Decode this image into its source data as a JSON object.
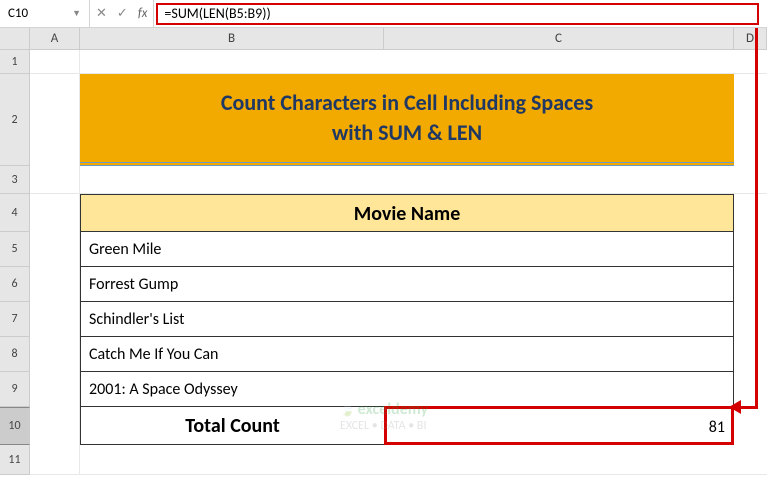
{
  "namebox": {
    "cell_ref": "C10"
  },
  "formula_bar": {
    "formula": "=SUM(LEN(B5:B9))"
  },
  "columns": {
    "A": "A",
    "B": "B",
    "C": "C",
    "D": "D"
  },
  "rows": [
    "1",
    "2",
    "3",
    "4",
    "5",
    "6",
    "7",
    "8",
    "9",
    "10",
    "11"
  ],
  "title": {
    "line1": "Count Characters in Cell Including Spaces",
    "line2": "with SUM & LEN"
  },
  "table": {
    "header": "Movie Name",
    "movies": [
      "Green Mile",
      "Forrest Gump",
      "Schindler's List",
      "Catch  Me If You Can",
      "2001: A Space Odyssey"
    ],
    "total_label": "Total Count",
    "total_value": "81"
  },
  "watermark": {
    "brand": "exceldemy",
    "tag": "EXCEL • DATA • BI"
  }
}
